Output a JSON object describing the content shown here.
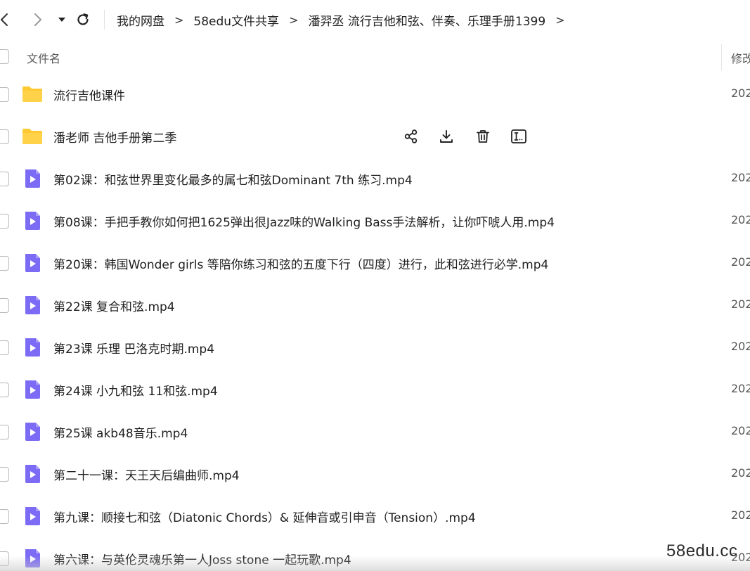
{
  "toolbar": {
    "breadcrumb": [
      {
        "label": "我的网盘"
      },
      {
        "label": "58edu文件共享"
      },
      {
        "label": "潘羿丞 流行吉他和弦、伴奏、乐理手册1399"
      }
    ],
    "separator": ">"
  },
  "table": {
    "header": {
      "name_label": "文件名",
      "modified_label": "修改"
    },
    "rows": [
      {
        "type": "folder",
        "name": "流行吉他课件",
        "date": "202"
      },
      {
        "type": "folder",
        "name": "潘老师  吉他手册第二季",
        "date": "",
        "hovered": true
      },
      {
        "type": "video",
        "name": "第02课：和弦世界里变化最多的属七和弦Dominant 7th 练习.mp4",
        "date": "202"
      },
      {
        "type": "video",
        "name": "第08课：手把手教你如何把1625弹出很Jazz味的Walking Bass手法解析，让你吓唬人用.mp4",
        "date": "202"
      },
      {
        "type": "video",
        "name": "第20课：韩国Wonder girls 等陪你练习和弦的五度下行（四度）进行，此和弦进行必学.mp4",
        "date": "202"
      },
      {
        "type": "video",
        "name": "第22课 复合和弦.mp4",
        "date": "202"
      },
      {
        "type": "video",
        "name": "第23课 乐理 巴洛克时期.mp4",
        "date": "202"
      },
      {
        "type": "video",
        "name": "第24课 小九和弦 11和弦.mp4",
        "date": "202"
      },
      {
        "type": "video",
        "name": "第25课  akb48音乐.mp4",
        "date": "202"
      },
      {
        "type": "video",
        "name": "第二十一课：天王天后编曲师.mp4",
        "date": "202"
      },
      {
        "type": "video",
        "name": "第九课：顺接七和弦（Diatonic Chords）& 延伸音或引申音（Tension）.mp4",
        "date": "202"
      },
      {
        "type": "video",
        "name": "第六课：与英伦灵魂乐第一人Joss stone 一起玩歌.mp4",
        "date": "202"
      }
    ]
  },
  "watermark": "58edu.cc",
  "icons": {
    "back": "chevron-left-icon",
    "forward": "chevron-right-icon",
    "history": "caret-down-icon",
    "refresh": "refresh-icon",
    "folder": "folder-icon",
    "video": "video-file-icon",
    "share": "share-icon",
    "download": "download-icon",
    "delete": "trash-icon",
    "rename": "rename-icon"
  },
  "colors": {
    "folder": "#FFC933",
    "video": "#7B6BF5",
    "text": "#1F1F1F"
  }
}
